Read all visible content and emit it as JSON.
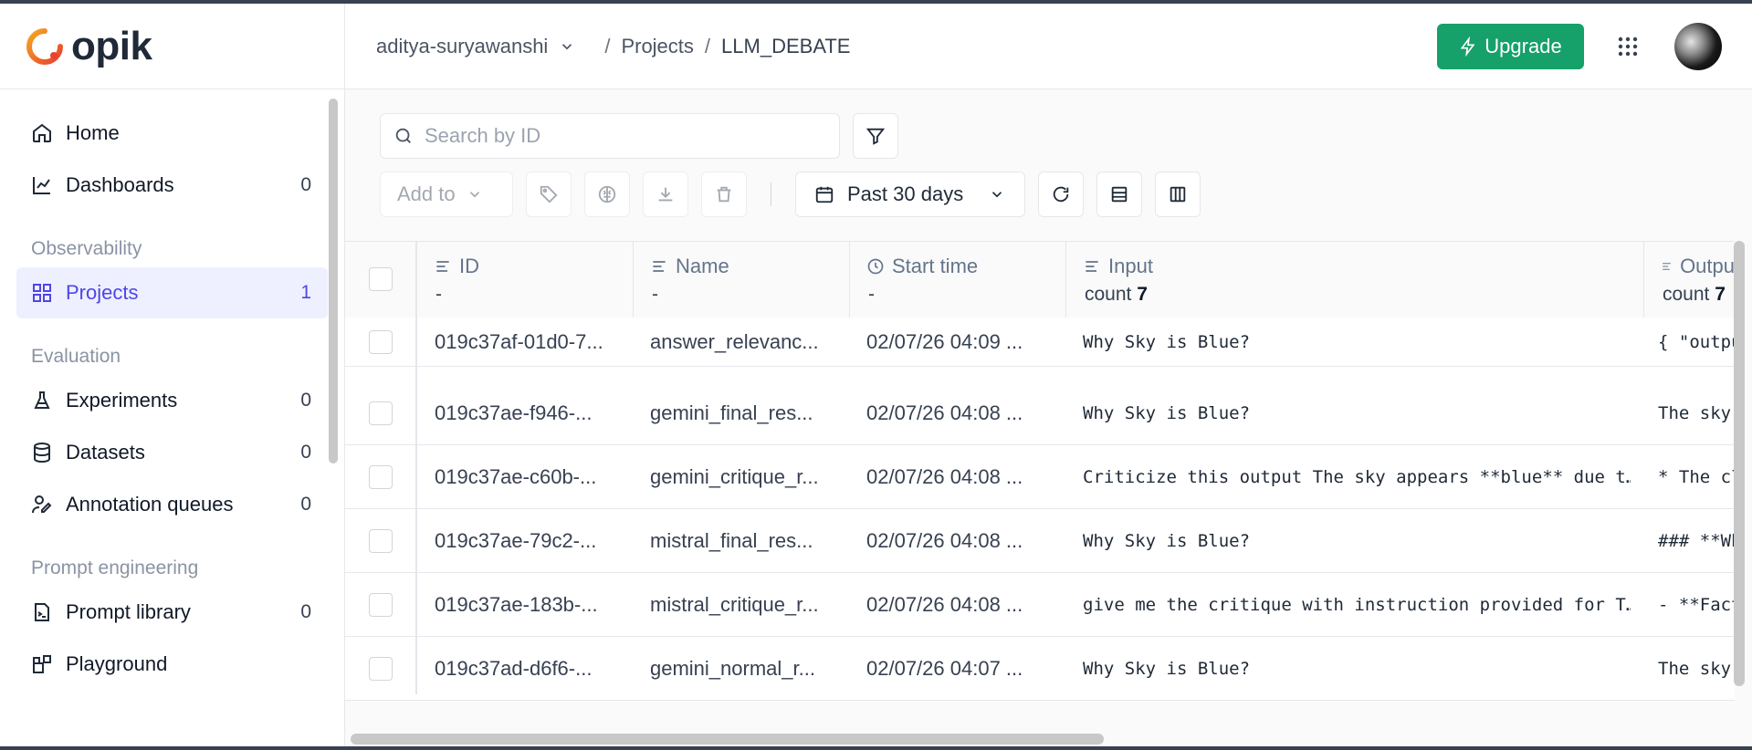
{
  "brand": {
    "logo_text": "opik"
  },
  "header": {
    "workspace": "aditya-suryawanshi",
    "crumb_projects": "Projects",
    "crumb_current": "LLM_DEBATE",
    "upgrade_label": "Upgrade"
  },
  "sidebar": {
    "items_top": [
      {
        "label": "Home",
        "icon": "home-icon",
        "count": ""
      },
      {
        "label": "Dashboards",
        "icon": "chart-icon",
        "count": "0"
      }
    ],
    "observability_title": "Observability",
    "projects": {
      "label": "Projects",
      "icon": "grid-icon",
      "count": "1"
    },
    "evaluation_title": "Evaluation",
    "evaluation_items": [
      {
        "label": "Experiments",
        "icon": "flask-icon",
        "count": "0"
      },
      {
        "label": "Datasets",
        "icon": "database-icon",
        "count": "0"
      },
      {
        "label": "Annotation queues",
        "icon": "annotation-icon",
        "count": "0"
      }
    ],
    "prompt_title": "Prompt engineering",
    "prompt_items": [
      {
        "label": "Prompt library",
        "icon": "prompt-icon",
        "count": "0"
      },
      {
        "label": "Playground",
        "icon": "blocks-icon",
        "count": ""
      }
    ]
  },
  "toolbar": {
    "search_placeholder": "Search by ID",
    "add_to_label": "Add to",
    "date_range": "Past 30 days"
  },
  "table": {
    "columns": [
      {
        "label": "ID",
        "sub": "-"
      },
      {
        "label": "Name",
        "sub": "-"
      },
      {
        "label": "Start time",
        "sub": "-"
      },
      {
        "label": "Input",
        "sub_prefix": "count",
        "sub_value": "7"
      },
      {
        "label": "Outpu",
        "sub_prefix": "count",
        "sub_value": "7"
      }
    ],
    "rows": [
      {
        "id": "019c37af-01d0-7...",
        "name": "answer_relevanc...",
        "start": "02/07/26 04:09 ...",
        "input": "Why Sky is Blue?",
        "output": "{ \"outpu"
      },
      {
        "id": "019c37ae-f946-...",
        "name": "gemini_final_res...",
        "start": "02/07/26 04:08 ...",
        "input": "Why Sky is Blue?",
        "output": "The sky"
      },
      {
        "id": "019c37ae-c60b-...",
        "name": "gemini_critique_r...",
        "start": "02/07/26 04:08 ...",
        "input": "Criticize this output The sky appears **blue** due t…",
        "output": "* The cl"
      },
      {
        "id": "019c37ae-79c2-...",
        "name": "mistral_final_res...",
        "start": "02/07/26 04:08 ...",
        "input": "Why Sky is Blue?",
        "output": "### **Wh"
      },
      {
        "id": "019c37ae-183b-...",
        "name": "mistral_critique_r...",
        "start": "02/07/26 04:08 ...",
        "input": "give me the critique with instruction provided for T…",
        "output": "- **Fact"
      },
      {
        "id": "019c37ad-d6f6-...",
        "name": "gemini_normal_r...",
        "start": "02/07/26 04:07 ...",
        "input": "Why Sky is Blue?",
        "output": "The sky"
      }
    ]
  },
  "colors": {
    "accent": "#4f46e5",
    "upgrade": "#16a06a",
    "logo_ring": "#f05a28"
  }
}
